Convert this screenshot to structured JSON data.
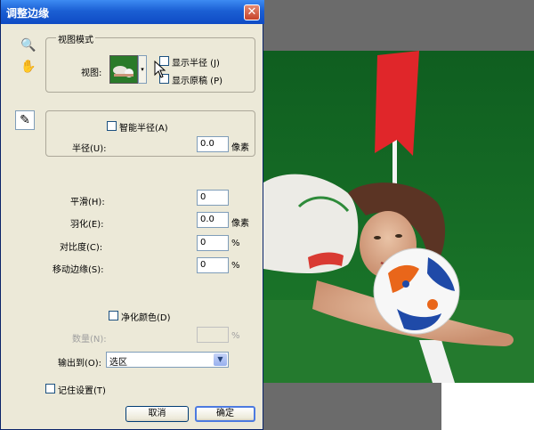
{
  "dialog": {
    "title": "调整边缘",
    "close_glyph": "✕"
  },
  "tools": {
    "zoom_glyph": "🔍",
    "hand_glyph": "✋",
    "brush_glyph": "✎"
  },
  "view_mode": {
    "group_title": "视图模式",
    "view_label": "视图:",
    "dropdown_glyph": "▾",
    "show_radius_label": "显示半径 (J)",
    "show_original_label": "显示原稿 (P)"
  },
  "edge_detection": {
    "smart_radius_label": "智能半径(A)",
    "radius_label": "半径(U):",
    "radius_value": "0.0",
    "radius_unit": "像素"
  },
  "adjust_edge": {
    "smooth_label": "平滑(H):",
    "smooth_value": "0",
    "feather_label": "羽化(E):",
    "feather_value": "0.0",
    "feather_unit": "像素",
    "contrast_label": "对比度(C):",
    "contrast_value": "0",
    "contrast_unit": "%",
    "shift_label": "移动边缘(S):",
    "shift_value": "0",
    "shift_unit": "%"
  },
  "output": {
    "decontaminate_label": "净化颜色(D)",
    "amount_label": "数量(N):",
    "amount_unit": "%",
    "output_to_label": "输出到(O):",
    "output_to_value": "选区",
    "select_arrow_glyph": "▼"
  },
  "footer": {
    "remember_label": "记住设置(T)",
    "cancel_label": "取消",
    "ok_label": "确定"
  },
  "colors": {
    "title_bar": "#1b5fd4",
    "dialog_bg": "#ece9d8",
    "field_border": "#7f9db9",
    "canvas_bg": "#6b6b6b",
    "grass": "#1f6b25",
    "flag": "#e0262a"
  }
}
